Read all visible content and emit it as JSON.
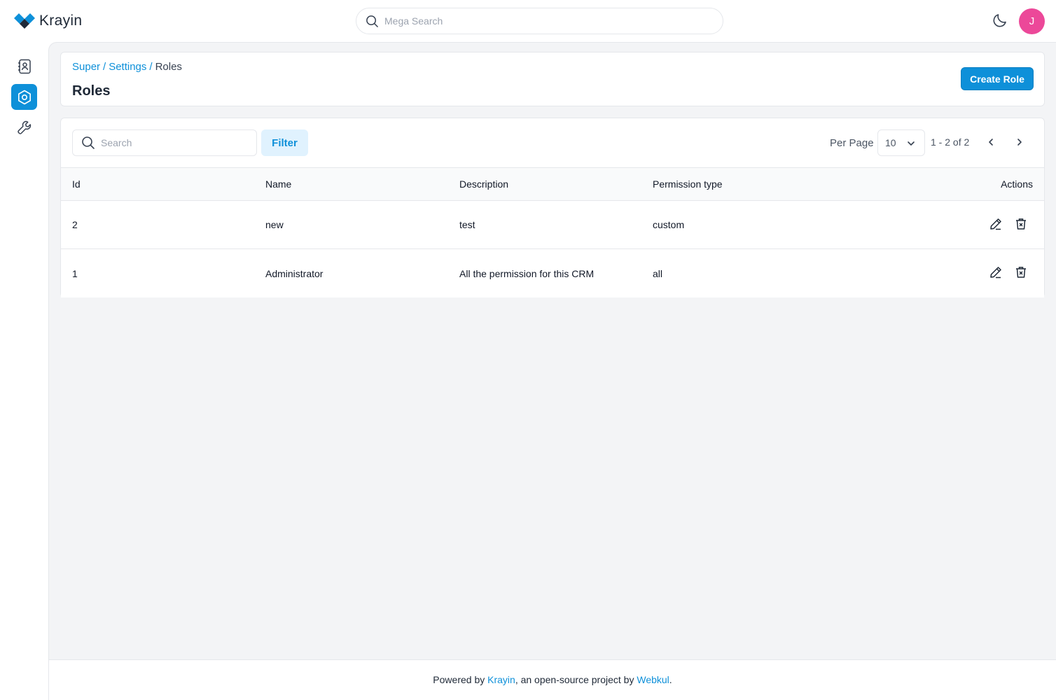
{
  "header": {
    "logo_text": "Krayin",
    "mega_search_placeholder": "Mega Search",
    "avatar_initial": "J",
    "avatar_color": "#ec4899"
  },
  "sidebar": {
    "items": [
      {
        "icon": "contacts-icon",
        "active": false
      },
      {
        "icon": "settings-icon",
        "active": true
      },
      {
        "icon": "wrench-icon",
        "active": false
      }
    ]
  },
  "breadcrumb": {
    "items": [
      "Super",
      "Settings",
      "Roles"
    ]
  },
  "page": {
    "title": "Roles",
    "create_button": "Create Role"
  },
  "toolbar": {
    "search_placeholder": "Search",
    "filter_label": "Filter",
    "per_page_label": "Per Page",
    "per_page_value": "10",
    "page_info": "1 - 2 of 2"
  },
  "table": {
    "columns": [
      "Id",
      "Name",
      "Description",
      "Permission type",
      "Actions"
    ],
    "rows": [
      {
        "id": "2",
        "name": "new",
        "description": "test",
        "permission_type": "custom"
      },
      {
        "id": "1",
        "name": "Administrator",
        "description": "All the permission for this CRM",
        "permission_type": "all"
      }
    ]
  },
  "footer": {
    "prefix": "Powered by ",
    "krayin_link": "Krayin",
    "middle": ", an open-source project by ",
    "webkul_link": "Webkul",
    "suffix": "."
  },
  "colors": {
    "accent": "#0e90d9",
    "background": "#f3f4f6"
  }
}
